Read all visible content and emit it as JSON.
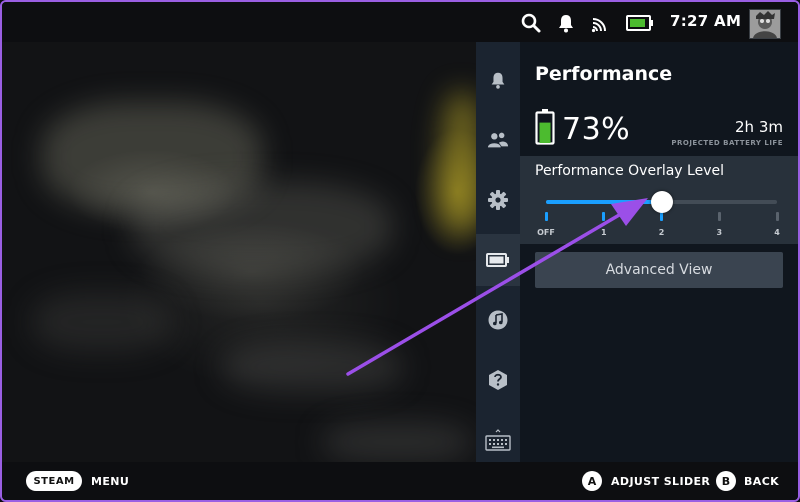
{
  "topbar": {
    "icons": [
      "search-icon",
      "notification-bell-icon",
      "wifi-icon",
      "battery-icon"
    ],
    "time": "7:27 AM",
    "avatar": "avatar"
  },
  "sidebar_tabs": [
    {
      "icon": "bell-icon"
    },
    {
      "icon": "friends-icon"
    },
    {
      "icon": "gear-icon"
    },
    {
      "icon": "battery-icon",
      "active": true
    },
    {
      "icon": "music-icon"
    },
    {
      "icon": "help-icon"
    },
    {
      "icon": "keyboard-icon"
    }
  ],
  "panel": {
    "title": "Performance",
    "battery_percent": "73%",
    "battery_level": 0.73,
    "projected_time": "2h 3m",
    "projected_label": "PROJECTED BATTERY LIFE",
    "overlay": {
      "label": "Performance Overlay Level",
      "levels": [
        "OFF",
        "1",
        "2",
        "3",
        "4"
      ],
      "selected_index": 2
    },
    "advanced_button": "Advanced View"
  },
  "bottombar": {
    "steam_label": "STEAM",
    "menu_label": "MENU",
    "a_label": "A",
    "adjust_label": "ADJUST SLIDER",
    "b_label": "B",
    "back_label": "BACK"
  },
  "colors": {
    "accent": "#1a9fff",
    "annotation_arrow": "#9b4fe8",
    "frame": "#9a5fe3",
    "battery_green": "#4cbb2f"
  }
}
